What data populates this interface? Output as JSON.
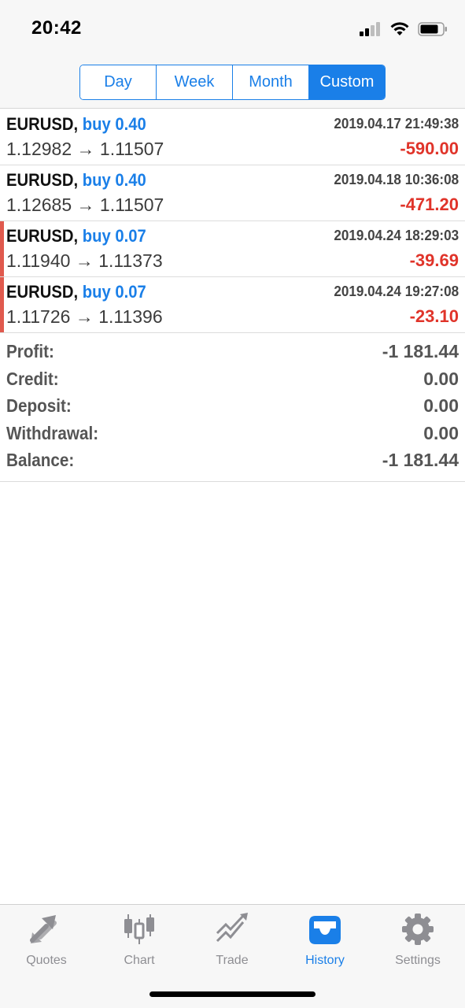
{
  "status_bar": {
    "time": "20:42"
  },
  "period_tabs": [
    {
      "label": "Day",
      "active": false
    },
    {
      "label": "Week",
      "active": false
    },
    {
      "label": "Month",
      "active": false
    },
    {
      "label": "Custom",
      "active": true
    }
  ],
  "deals": [
    {
      "symbol": "EURUSD,",
      "side": "buy 0.40",
      "time": "2019.04.17 21:49:38",
      "prices": "1.12982 → 1.11507",
      "profit": "-590.00",
      "flagged": false
    },
    {
      "symbol": "EURUSD,",
      "side": "buy 0.40",
      "time": "2019.04.18 10:36:08",
      "prices": "1.12685 → 1.11507",
      "profit": "-471.20",
      "flagged": false
    },
    {
      "symbol": "EURUSD,",
      "side": "buy 0.07",
      "time": "2019.04.24 18:29:03",
      "prices": "1.11940 → 1.11373",
      "profit": "-39.69",
      "flagged": true
    },
    {
      "symbol": "EURUSD,",
      "side": "buy 0.07",
      "time": "2019.04.24 19:27:08",
      "prices": "1.11726 → 1.11396",
      "profit": "-23.10",
      "flagged": true
    }
  ],
  "summary": [
    {
      "label": "Profit:",
      "value": "-1 181.44"
    },
    {
      "label": "Credit:",
      "value": "0.00"
    },
    {
      "label": "Deposit:",
      "value": "0.00"
    },
    {
      "label": "Withdrawal:",
      "value": "0.00"
    },
    {
      "label": "Balance:",
      "value": "-1 181.44"
    }
  ],
  "tab_bar": [
    {
      "label": "Quotes",
      "icon": "quotes-icon",
      "active": false
    },
    {
      "label": "Chart",
      "icon": "chart-icon",
      "active": false
    },
    {
      "label": "Trade",
      "icon": "trade-icon",
      "active": false
    },
    {
      "label": "History",
      "icon": "history-icon",
      "active": true
    },
    {
      "label": "Settings",
      "icon": "settings-icon",
      "active": false
    }
  ],
  "colors": {
    "accent": "#1a7fe8",
    "loss": "#e0342a",
    "flag": "#e05a4e",
    "inactive_tab": "#8e8e93"
  }
}
